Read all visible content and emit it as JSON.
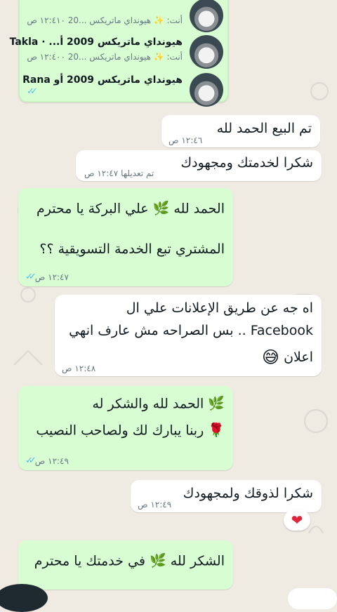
{
  "shared_card": {
    "rows": [
      {
        "title": "",
        "subtitle": "أنت: ✨ هيونداي ماتريكس ...20 ۱۲:٤١٠ ص"
      },
      {
        "title": "هيونداي ماتريكس 2009 أ... · Takla",
        "subtitle": "أنت: ✨ هيونداي ماتريكس ...20 ۱۲:٤٠٠ ص"
      },
      {
        "title": "هيونداي ماتريكس 2009 أو Rana",
        "subtitle": ""
      }
    ]
  },
  "messages": [
    {
      "lines": [
        "تم البيع الحمد لله"
      ],
      "time": "١٢:٤٦ ص"
    },
    {
      "lines": [
        "شكرا لخدمتك ومجهودك"
      ],
      "time": "١٢:٤٧ ص",
      "edited": "تم تعديلها"
    },
    {
      "lines": [
        "الحمد لله",
        "علي البركة يا محترم",
        "المشتري تبع الخدمة التسويقية ؟؟"
      ],
      "time": "١٢:٤٧ ص"
    },
    {
      "lines": [
        "اه جه عن طريق الإعلانات علي ال",
        "Facebook .. بس الصراحه مش عارف انهي",
        "اعلان"
      ],
      "time": "١٢:٤٨ ص"
    },
    {
      "lines": [
        "الحمد لله والشكر له",
        "ربنا يبارك لك ولصاحب النصيب"
      ],
      "time": "١٢:٤٩ ص"
    },
    {
      "lines": [
        "شكرا لذوقك ولمجهودك"
      ],
      "time": "١٢:٤٩ ص"
    },
    {
      "lines": [
        "الشكر لله",
        "في خدمتك يا محترم"
      ]
    }
  ],
  "icons": {
    "herb": "herb-emoji",
    "rose": "rose-emoji",
    "heart": "heart-emoji",
    "laugh": "laugh-emoji"
  },
  "colors": {
    "sent": "#d9fdd3",
    "received": "#ffffff",
    "read_ticks": "#53bdeb",
    "background": "#efeae2"
  }
}
